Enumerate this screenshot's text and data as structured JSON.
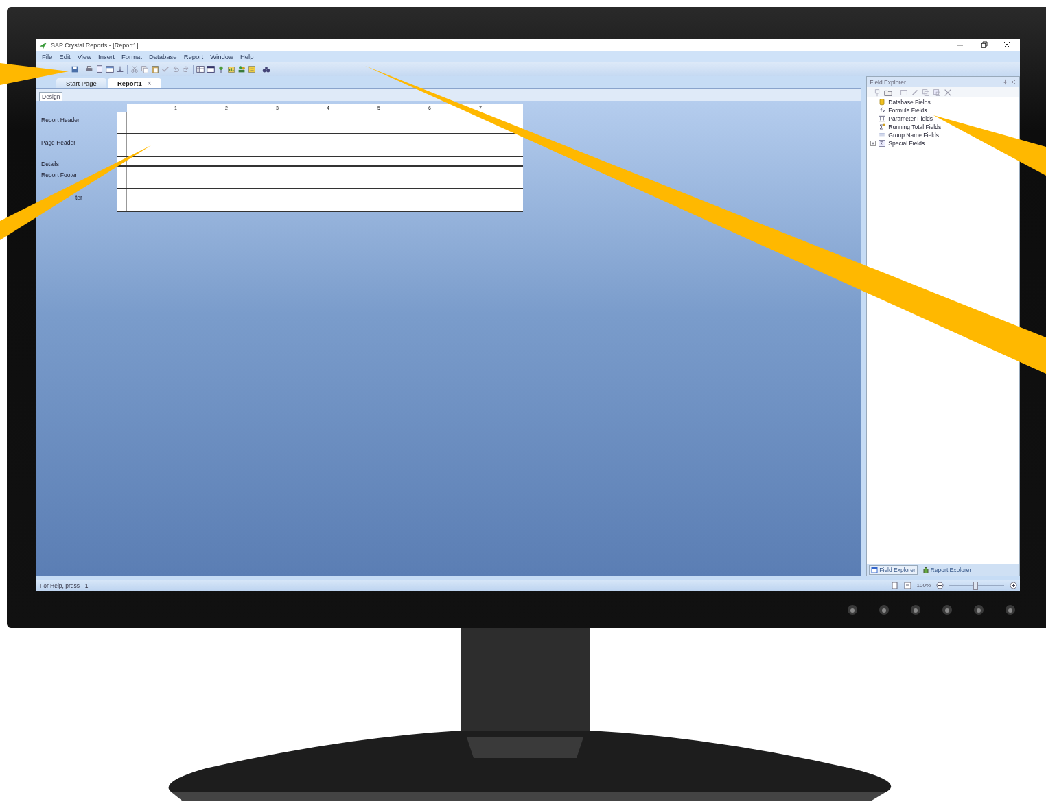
{
  "window": {
    "title": "SAP Crystal Reports - [Report1]"
  },
  "menu": [
    "File",
    "Edit",
    "View",
    "Insert",
    "Format",
    "Database",
    "Report",
    "Window",
    "Help"
  ],
  "document_tabs": [
    {
      "label": "Start Page",
      "selected": false
    },
    {
      "label": "Report1",
      "selected": true,
      "close": "×"
    }
  ],
  "view_tabs": [
    {
      "label": "Design",
      "selected": true
    }
  ],
  "ruler": [
    "1",
    "2",
    "3",
    "4",
    "5",
    "6",
    "7"
  ],
  "sections": [
    {
      "label": "Report Header",
      "kind": "band"
    },
    {
      "label": "Page Header",
      "kind": "band"
    },
    {
      "label": "Details",
      "kind": "strip"
    },
    {
      "label": "Report Footer",
      "kind": "band"
    },
    {
      "label": "ter",
      "kind": "band"
    }
  ],
  "field_explorer": {
    "title": "Field Explorer",
    "items": [
      {
        "label": "Database Fields",
        "kind": "leaf"
      },
      {
        "label": "Formula Fields",
        "kind": "leaf"
      },
      {
        "label": "Parameter Fields",
        "kind": "leaf"
      },
      {
        "label": "Running Total Fields",
        "kind": "leaf"
      },
      {
        "label": "Group Name Fields",
        "kind": "leaf"
      },
      {
        "label": "Special Fields",
        "kind": "collapsible",
        "expanded": false
      }
    ],
    "tabs": [
      {
        "label": "Field Explorer",
        "selected": true
      },
      {
        "label": "Report Explorer",
        "selected": false
      }
    ]
  },
  "status_bar": {
    "text": "For Help, press F1",
    "zoom": "100%",
    "zoom_slider": {
      "level": 0.48
    }
  }
}
